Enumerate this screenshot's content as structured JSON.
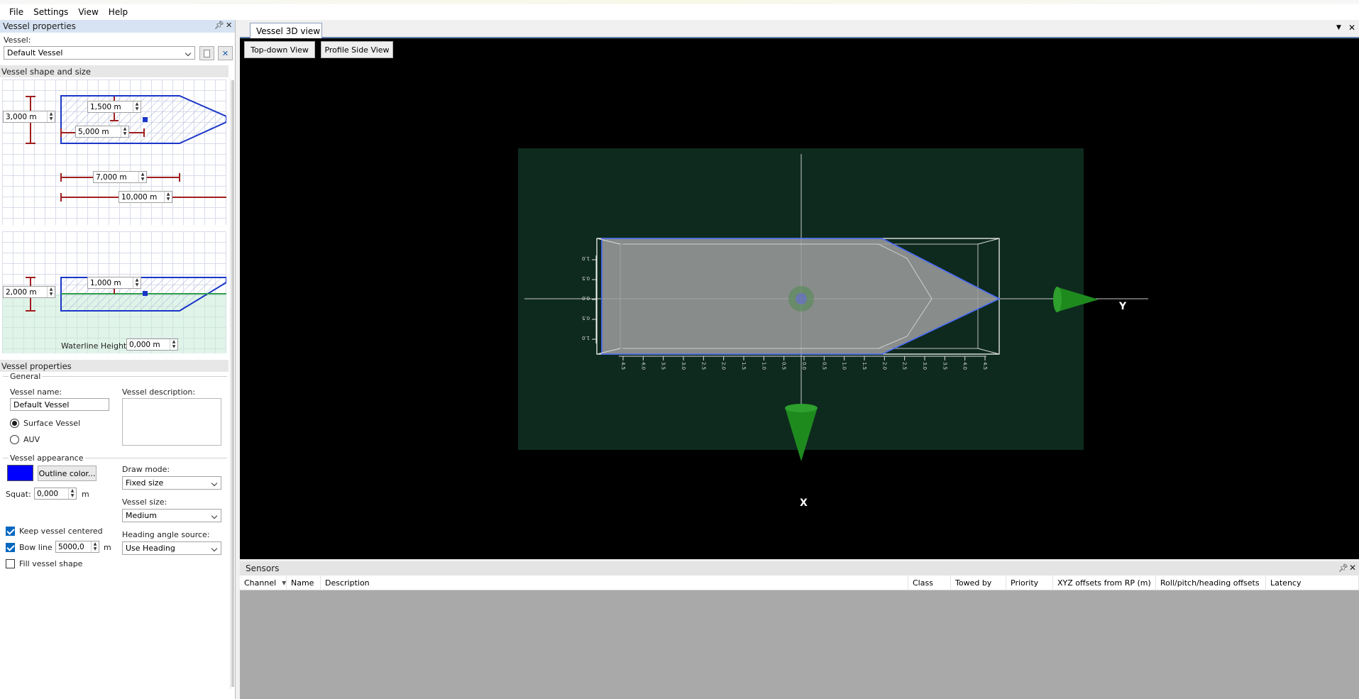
{
  "menu": [
    "File",
    "Settings",
    "View",
    "Help"
  ],
  "vessel_panel": {
    "title": "Vessel properties",
    "vessel_label": "Vessel:",
    "vessel_selected": "Default Vessel",
    "shape_section": "Vessel shape and size",
    "top_dims": {
      "width": "3,000 m",
      "bow_offset": "1,500 m",
      "rp_offset": "5,000 m",
      "hull_length": "7,000 m",
      "total_length": "10,000 m"
    },
    "side_dims": {
      "height": "2,000 m",
      "draft": "1,000 m"
    },
    "waterline_label": "Waterline Height:",
    "waterline_value": "0,000 m",
    "props_section": "Vessel properties",
    "general_label": "General",
    "name_label": "Vessel name:",
    "name_value": "Default Vessel",
    "desc_label": "Vessel description:",
    "desc_value": "",
    "type_options": [
      "Surface Vessel",
      "AUV"
    ],
    "type_selected": "Surface Vessel",
    "appearance_label": "Vessel appearance",
    "outline_color_btn": "Outline color...",
    "outline_color": "#0000ff",
    "squat_label": "Squat:",
    "squat_value": "0,000",
    "squat_unit": "m",
    "keep_centered_label": "Keep vessel centered",
    "keep_centered": true,
    "bow_line_label": "Bow line",
    "bow_line": true,
    "bow_line_value": "5000,0",
    "bow_line_unit": "m",
    "fill_shape_label": "Fill vessel shape",
    "fill_shape": false,
    "draw_mode_label": "Draw mode:",
    "draw_mode_value": "Fixed size",
    "vessel_size_label": "Vessel size:",
    "vessel_size_value": "Medium",
    "heading_source_label": "Heading angle source:",
    "heading_source_value": "Use Heading"
  },
  "doc": {
    "tab_label": "Vessel 3D view",
    "topdown_btn": "Top-down View",
    "profile_btn": "Profile Side View",
    "axis_y_label": "Y",
    "axis_x_label": "X",
    "ruler_ticks_x": [
      "4.5",
      "4.0",
      "3.5",
      "3.0",
      "2.5",
      "2.0",
      "1.5",
      "1.0",
      "0.5",
      "0.0",
      "0.5",
      "1.0",
      "1.5",
      "2.0",
      "2.5",
      "3.0",
      "3.5",
      "4.0",
      "4.5"
    ],
    "ruler_ticks_y": [
      "1.0",
      "0.5",
      "0.0",
      "0.5",
      "1.0"
    ],
    "scene_bg": "#0e2a1e",
    "axis_cone_color": "#1e8a1e"
  },
  "sensors": {
    "title": "Sensors",
    "columns": [
      "Channel",
      "Name",
      "Description",
      "Class",
      "Towed by",
      "Priority",
      "XYZ offsets from RP (m)",
      "Roll/pitch/heading offsets",
      "Latency"
    ]
  }
}
